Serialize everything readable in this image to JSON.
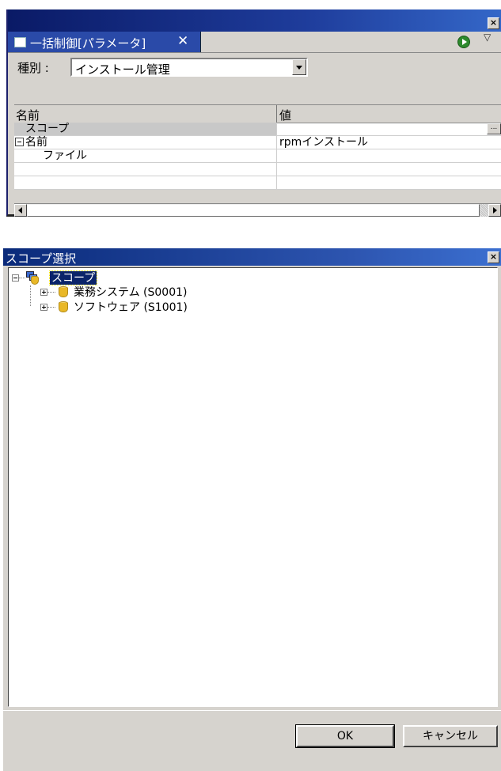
{
  "parameter_view": {
    "tab_label": "一括制御[パラメータ]",
    "tab_close": "✕",
    "close_glyph": "×",
    "menu_glyph": "▽",
    "type_label": "種別 :",
    "type_value": "インストール管理",
    "grid": {
      "headers": [
        "名前",
        "値"
      ],
      "rows": [
        {
          "name": "スコープ",
          "value": "",
          "ellipsis": "..."
        },
        {
          "name": "名前",
          "value": "rpmインストール"
        },
        {
          "name": "ファイル",
          "value": ""
        }
      ]
    }
  },
  "scope_dialog": {
    "title": "スコープ選択",
    "close_glyph": "×",
    "tree": {
      "root": "スコープ",
      "children": [
        "業務システム (S0001)",
        "ソフトウェア (S1001)"
      ]
    },
    "ok_label": "OK",
    "cancel_label": "キャンセル"
  }
}
